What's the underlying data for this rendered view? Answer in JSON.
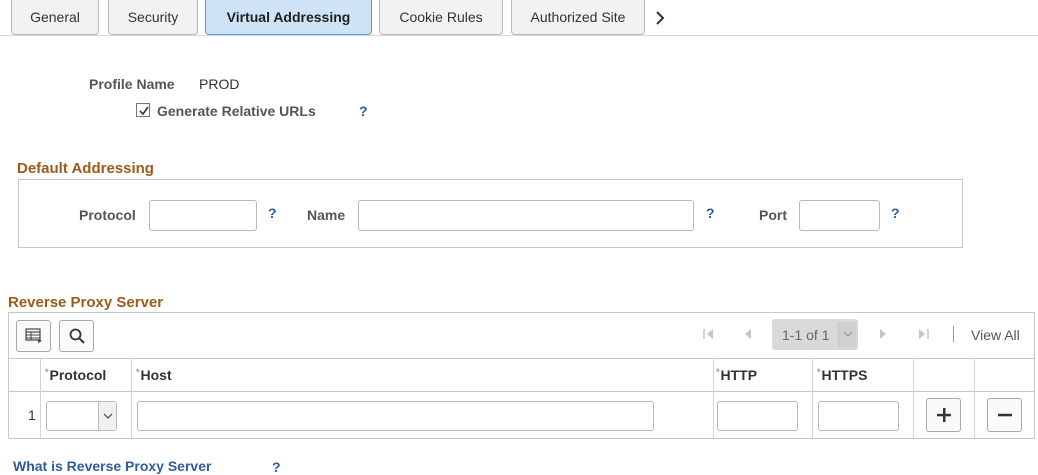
{
  "tabs": [
    {
      "label": "General",
      "active": false
    },
    {
      "label": "Security",
      "active": false
    },
    {
      "label": "Virtual Addressing",
      "active": true
    },
    {
      "label": "Cookie Rules",
      "active": false
    },
    {
      "label": "Authorized Site",
      "active": false
    }
  ],
  "profile": {
    "name_label": "Profile Name",
    "name_value": "PROD",
    "relative_urls_label": "Generate Relative URLs",
    "relative_urls_checked": true,
    "help": "?"
  },
  "default_addressing": {
    "title": "Default Addressing",
    "protocol_label": "Protocol",
    "protocol_value": "",
    "name_label": "Name",
    "name_value": "",
    "port_label": "Port",
    "port_value": "",
    "help": "?"
  },
  "reverse_proxy": {
    "title": "Reverse Proxy Server",
    "pager_text": "1-1 of 1",
    "view_all": "View All",
    "columns": [
      "Protocol",
      "Host",
      "HTTP",
      "HTTPS"
    ],
    "required_marker": "*",
    "rows": [
      {
        "num": "1",
        "protocol": "",
        "host": "",
        "http": "",
        "https": ""
      }
    ]
  },
  "footer": {
    "link": "What is Reverse Proxy Server",
    "help": "?"
  },
  "colors": {
    "active_tab_bg": "#cfe3f7",
    "active_tab_border": "#5d9bd5",
    "section_title": "#9a5b1c",
    "help_link": "#2f5d9a"
  }
}
